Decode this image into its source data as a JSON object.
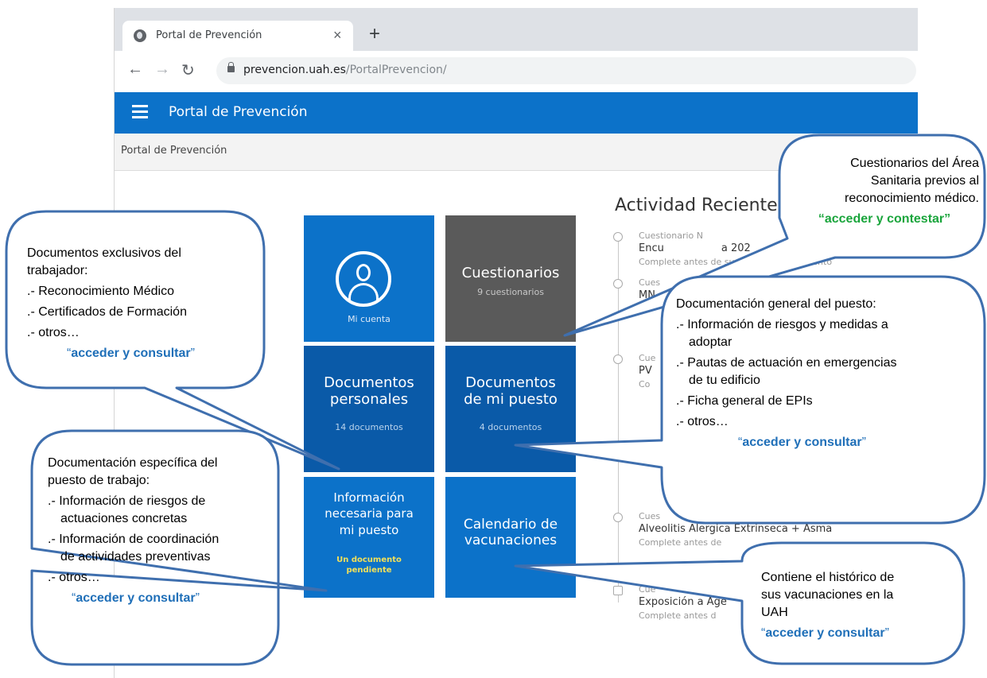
{
  "browser": {
    "tab_title": "Portal de Prevención",
    "tab_close": "×",
    "new_tab": "+",
    "url_host": "prevencion.uah.es",
    "url_path": "/PortalPrevencion/"
  },
  "app": {
    "title": "Portal de Prevención",
    "breadcrumb": "Portal de Prevención"
  },
  "tiles": {
    "mi_cuenta": {
      "label": "Mi cuenta"
    },
    "cuestionarios": {
      "title": "Cuestionarios",
      "subtitle": "9 cuestionarios"
    },
    "doc_personales": {
      "title1": "Documentos",
      "title2": "personales",
      "subtitle": "14 documentos"
    },
    "doc_puesto": {
      "title1": "Documentos",
      "title2": "de mi puesto",
      "subtitle": "4 documentos"
    },
    "info_necesaria": {
      "title1": "Información",
      "title2": "necesaria para",
      "title3": "mi puesto",
      "badge1": "Un documento",
      "badge2": "pendiente"
    },
    "calendario": {
      "title1": "Calendario de",
      "title2": "vacunaciones"
    }
  },
  "activity": {
    "heading": "Actividad Reciente",
    "items": [
      {
        "label": "Cuestionario N",
        "title": "Encu",
        "title_end": "a 202",
        "desc": "Complete antes de su cita a reconocimiento"
      },
      {
        "label": "Cues",
        "title": "MN",
        "desc": "Co"
      },
      {
        "label": "Cue",
        "title": "PV",
        "desc": "Co"
      },
      {
        "label": "Cues",
        "title": "Alveolitis Alergica Extrinseca + Asma",
        "desc": "Complete antes de"
      },
      {
        "label": "Cue",
        "title": "Exposición a Age",
        "desc": "Complete antes d"
      }
    ]
  },
  "callouts": {
    "trabajador": {
      "line1": "Documentos exclusivos del",
      "line2": "trabajador:",
      "items": [
        ".- Reconocimiento Médico",
        ".- Certificados de Formación",
        ".- otros…"
      ],
      "cta": "acceder y consultar",
      "quote_open": "“",
      "quote_close": "”"
    },
    "especifica": {
      "line1": "Documentación específica del",
      "line2": "puesto de trabajo:",
      "item1a": ".- Información de riesgos de",
      "item1b": "actuaciones concretas",
      "item2a": ".- Información de coordinación",
      "item2b": "de actividades preventivas",
      "item3": ".- otros…",
      "cta": "acceder y consultar",
      "quote_open": "“",
      "quote_close": "”"
    },
    "cuestionarios": {
      "line1": "Cuestionarios del Área",
      "line2": "Sanitaria previos al",
      "line3": "reconocimiento médico.",
      "cta": "“acceder y contestar”"
    },
    "general": {
      "line1": "Documentación general del puesto:",
      "item1a": ".- Información de riesgos y medidas a",
      "item1b": "adoptar",
      "item2a": ".- Pautas de actuación en emergencias",
      "item2b": "de tu edificio",
      "item3": ".- Ficha general de EPIs",
      "item4": ".- otros…",
      "cta": "acceder y consultar",
      "quote_open": "“",
      "quote_close": "”"
    },
    "vacunaciones": {
      "line1": "Contiene el histórico de",
      "line2": "sus vacunaciones en la",
      "line3": "UAH",
      "cta": "acceder y consultar",
      "quote_open": "“",
      "quote_close": "”"
    }
  },
  "colors": {
    "app_bar": "#0c72c9",
    "tile_blue": "#0c72c9",
    "tile_dark": "#0a5aa8",
    "tile_gray": "#5a5a5a",
    "callout_border": "#3f6fae",
    "cta_blue": "#1f6fb8",
    "cta_green": "#1aa53c",
    "badge_yellow": "#f1e05a"
  }
}
